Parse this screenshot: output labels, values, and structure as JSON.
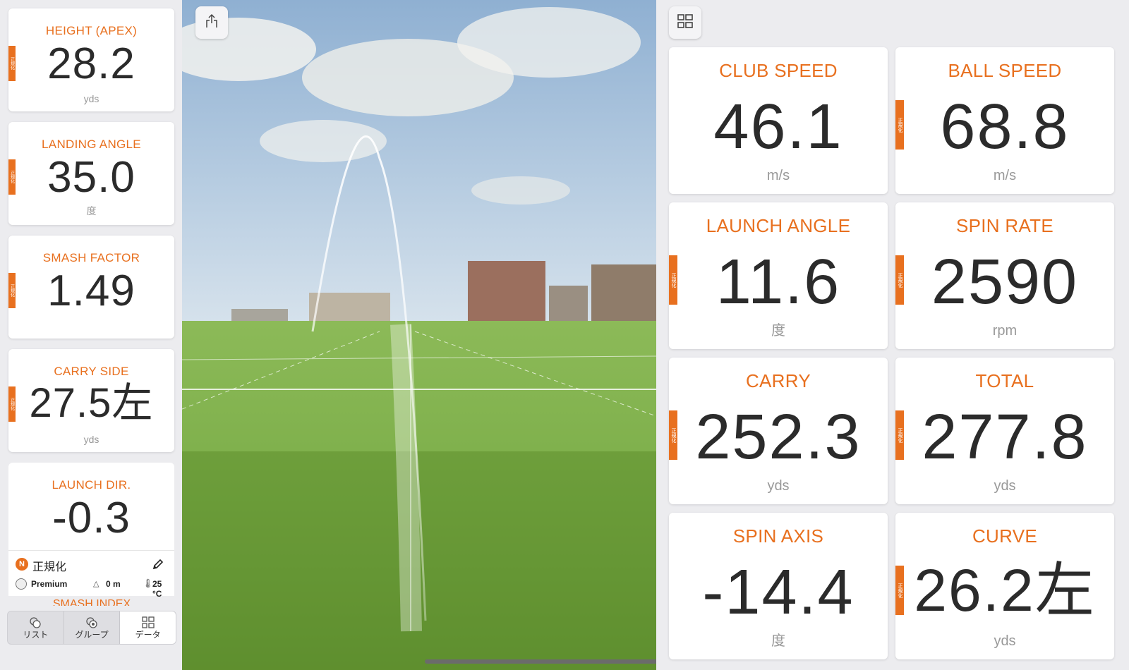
{
  "normalize_tag": "正規化",
  "left_cards": [
    {
      "label": "HEIGHT (APEX)",
      "value": "28.2",
      "unit": "yds"
    },
    {
      "label": "LANDING ANGLE",
      "value": "35.0",
      "unit": "度"
    },
    {
      "label": "SMASH FACTOR",
      "value": "1.49",
      "unit": ""
    },
    {
      "label": "CARRY SIDE",
      "value": "27.5左",
      "unit": "yds"
    },
    {
      "label": "LAUNCH DIR.",
      "value": "-0.3",
      "unit": ""
    }
  ],
  "status_panel": {
    "badge": "N",
    "label": "正規化",
    "ball_type": "Premium",
    "altitude": "0 m",
    "temperature": "25 °C"
  },
  "peek_label": "SMASH INDEX",
  "tabs": [
    {
      "label": "リスト"
    },
    {
      "label": "グループ"
    },
    {
      "label": "データ"
    }
  ],
  "right_cards": [
    {
      "label": "CLUB SPEED",
      "value": "46.1",
      "unit": "m/s"
    },
    {
      "label": "BALL SPEED",
      "value": "68.8",
      "unit": "m/s"
    },
    {
      "label": "LAUNCH ANGLE",
      "value": "11.6",
      "unit": "度"
    },
    {
      "label": "SPIN RATE",
      "value": "2590",
      "unit": "rpm"
    },
    {
      "label": "CARRY",
      "value": "252.3",
      "unit": "yds"
    },
    {
      "label": "TOTAL",
      "value": "277.8",
      "unit": "yds"
    },
    {
      "label": "SPIN AXIS",
      "value": "-14.4",
      "unit": "度"
    },
    {
      "label": "CURVE",
      "value": "26.2左",
      "unit": "yds"
    }
  ],
  "icons": {
    "share": "share-icon",
    "grid": "grid-layout-icon",
    "pencil": "pencil-icon"
  },
  "colors": {
    "accent": "#e8701f",
    "card_bg": "#ffffff",
    "page_bg": "#ececef",
    "value_text": "#2b2b2b"
  }
}
